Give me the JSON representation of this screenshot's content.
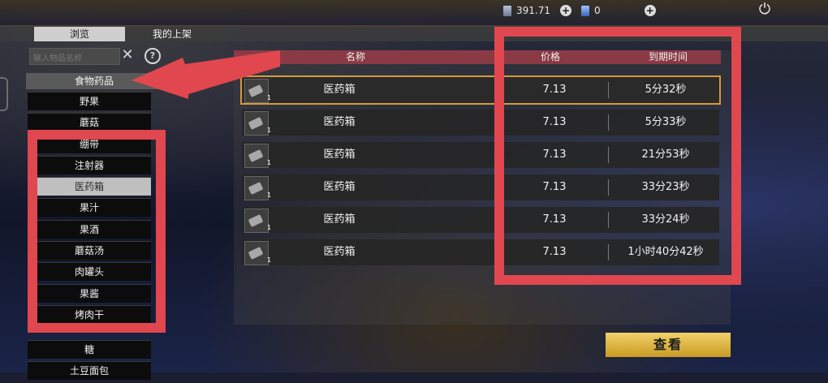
{
  "currency": {
    "coins": "391.71",
    "cards": "0"
  },
  "tabs": {
    "browse": "浏览",
    "my_listings": "我的上架"
  },
  "search": {
    "placeholder": "输入物品名称"
  },
  "category": {
    "header": "食物药品",
    "items_top": [
      "野果",
      "蘑菇",
      "绷带"
    ],
    "items_mid": [
      "注射器",
      "医药箱",
      "果汁",
      "果酒",
      "蘑菇汤",
      "肉罐头",
      "果酱",
      "烤肉干"
    ],
    "selected": "医药箱",
    "items_bottom": [
      "糖",
      "土豆面包"
    ]
  },
  "table": {
    "headers": {
      "name": "名称",
      "price": "价格",
      "expiry": "到期时间"
    },
    "rows": [
      {
        "name": "医药箱",
        "qty": "1",
        "price": "7.13",
        "expiry": "5分32秒"
      },
      {
        "name": "医药箱",
        "qty": "1",
        "price": "7.13",
        "expiry": "5分33秒"
      },
      {
        "name": "医药箱",
        "qty": "1",
        "price": "7.13",
        "expiry": "21分53秒"
      },
      {
        "name": "医药箱",
        "qty": "1",
        "price": "7.13",
        "expiry": "33分23秒"
      },
      {
        "name": "医药箱",
        "qty": "1",
        "price": "7.13",
        "expiry": "33分24秒"
      },
      {
        "name": "医药箱",
        "qty": "1",
        "price": "7.13",
        "expiry": "1小时40分42秒"
      }
    ]
  },
  "view_button": "查看",
  "colors": {
    "highlight": "#e0474f",
    "header_bar": "#8a3a44",
    "button_gold": "#e2bb4a",
    "selected_outline": "#d59a3a"
  },
  "icons": [
    "coin-icon",
    "card-icon",
    "plus-icon",
    "power-icon",
    "clear-icon",
    "help-icon",
    "medkit-icon",
    "arrow-annotation"
  ]
}
